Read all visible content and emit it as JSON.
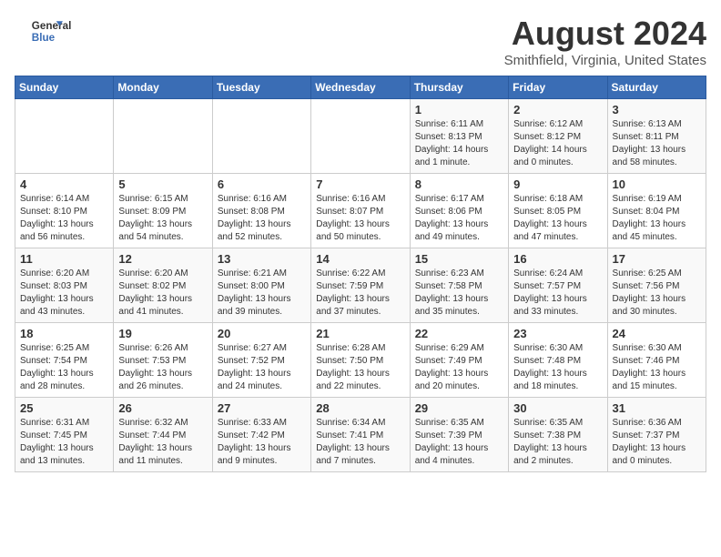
{
  "header": {
    "logo_general": "General",
    "logo_blue": "Blue",
    "title": "August 2024",
    "subtitle": "Smithfield, Virginia, United States"
  },
  "calendar": {
    "days_of_week": [
      "Sunday",
      "Monday",
      "Tuesday",
      "Wednesday",
      "Thursday",
      "Friday",
      "Saturday"
    ],
    "weeks": [
      [
        {
          "day": "",
          "info": ""
        },
        {
          "day": "",
          "info": ""
        },
        {
          "day": "",
          "info": ""
        },
        {
          "day": "",
          "info": ""
        },
        {
          "day": "1",
          "info": "Sunrise: 6:11 AM\nSunset: 8:13 PM\nDaylight: 14 hours\nand 1 minute."
        },
        {
          "day": "2",
          "info": "Sunrise: 6:12 AM\nSunset: 8:12 PM\nDaylight: 14 hours\nand 0 minutes."
        },
        {
          "day": "3",
          "info": "Sunrise: 6:13 AM\nSunset: 8:11 PM\nDaylight: 13 hours\nand 58 minutes."
        }
      ],
      [
        {
          "day": "4",
          "info": "Sunrise: 6:14 AM\nSunset: 8:10 PM\nDaylight: 13 hours\nand 56 minutes."
        },
        {
          "day": "5",
          "info": "Sunrise: 6:15 AM\nSunset: 8:09 PM\nDaylight: 13 hours\nand 54 minutes."
        },
        {
          "day": "6",
          "info": "Sunrise: 6:16 AM\nSunset: 8:08 PM\nDaylight: 13 hours\nand 52 minutes."
        },
        {
          "day": "7",
          "info": "Sunrise: 6:16 AM\nSunset: 8:07 PM\nDaylight: 13 hours\nand 50 minutes."
        },
        {
          "day": "8",
          "info": "Sunrise: 6:17 AM\nSunset: 8:06 PM\nDaylight: 13 hours\nand 49 minutes."
        },
        {
          "day": "9",
          "info": "Sunrise: 6:18 AM\nSunset: 8:05 PM\nDaylight: 13 hours\nand 47 minutes."
        },
        {
          "day": "10",
          "info": "Sunrise: 6:19 AM\nSunset: 8:04 PM\nDaylight: 13 hours\nand 45 minutes."
        }
      ],
      [
        {
          "day": "11",
          "info": "Sunrise: 6:20 AM\nSunset: 8:03 PM\nDaylight: 13 hours\nand 43 minutes."
        },
        {
          "day": "12",
          "info": "Sunrise: 6:20 AM\nSunset: 8:02 PM\nDaylight: 13 hours\nand 41 minutes."
        },
        {
          "day": "13",
          "info": "Sunrise: 6:21 AM\nSunset: 8:00 PM\nDaylight: 13 hours\nand 39 minutes."
        },
        {
          "day": "14",
          "info": "Sunrise: 6:22 AM\nSunset: 7:59 PM\nDaylight: 13 hours\nand 37 minutes."
        },
        {
          "day": "15",
          "info": "Sunrise: 6:23 AM\nSunset: 7:58 PM\nDaylight: 13 hours\nand 35 minutes."
        },
        {
          "day": "16",
          "info": "Sunrise: 6:24 AM\nSunset: 7:57 PM\nDaylight: 13 hours\nand 33 minutes."
        },
        {
          "day": "17",
          "info": "Sunrise: 6:25 AM\nSunset: 7:56 PM\nDaylight: 13 hours\nand 30 minutes."
        }
      ],
      [
        {
          "day": "18",
          "info": "Sunrise: 6:25 AM\nSunset: 7:54 PM\nDaylight: 13 hours\nand 28 minutes."
        },
        {
          "day": "19",
          "info": "Sunrise: 6:26 AM\nSunset: 7:53 PM\nDaylight: 13 hours\nand 26 minutes."
        },
        {
          "day": "20",
          "info": "Sunrise: 6:27 AM\nSunset: 7:52 PM\nDaylight: 13 hours\nand 24 minutes."
        },
        {
          "day": "21",
          "info": "Sunrise: 6:28 AM\nSunset: 7:50 PM\nDaylight: 13 hours\nand 22 minutes."
        },
        {
          "day": "22",
          "info": "Sunrise: 6:29 AM\nSunset: 7:49 PM\nDaylight: 13 hours\nand 20 minutes."
        },
        {
          "day": "23",
          "info": "Sunrise: 6:30 AM\nSunset: 7:48 PM\nDaylight: 13 hours\nand 18 minutes."
        },
        {
          "day": "24",
          "info": "Sunrise: 6:30 AM\nSunset: 7:46 PM\nDaylight: 13 hours\nand 15 minutes."
        }
      ],
      [
        {
          "day": "25",
          "info": "Sunrise: 6:31 AM\nSunset: 7:45 PM\nDaylight: 13 hours\nand 13 minutes."
        },
        {
          "day": "26",
          "info": "Sunrise: 6:32 AM\nSunset: 7:44 PM\nDaylight: 13 hours\nand 11 minutes."
        },
        {
          "day": "27",
          "info": "Sunrise: 6:33 AM\nSunset: 7:42 PM\nDaylight: 13 hours\nand 9 minutes."
        },
        {
          "day": "28",
          "info": "Sunrise: 6:34 AM\nSunset: 7:41 PM\nDaylight: 13 hours\nand 7 minutes."
        },
        {
          "day": "29",
          "info": "Sunrise: 6:35 AM\nSunset: 7:39 PM\nDaylight: 13 hours\nand 4 minutes."
        },
        {
          "day": "30",
          "info": "Sunrise: 6:35 AM\nSunset: 7:38 PM\nDaylight: 13 hours\nand 2 minutes."
        },
        {
          "day": "31",
          "info": "Sunrise: 6:36 AM\nSunset: 7:37 PM\nDaylight: 13 hours\nand 0 minutes."
        }
      ]
    ]
  }
}
